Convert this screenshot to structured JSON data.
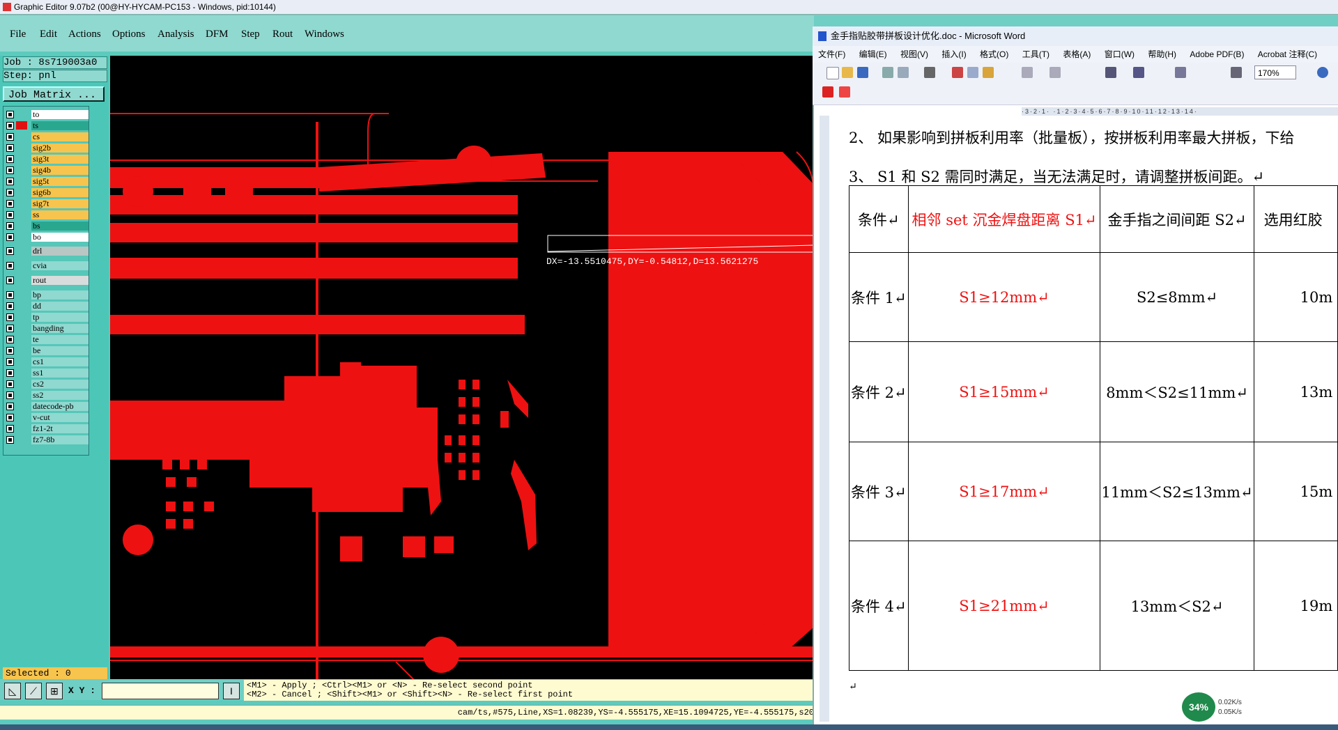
{
  "ge": {
    "title": "Graphic Editor 9.07b2 (00@HY-HYCAM-PC153 - Windows, pid:10144)",
    "menu": [
      "File",
      "Edit",
      "Actions",
      "Options",
      "Analysis",
      "DFM",
      "Step",
      "Rout",
      "Windows"
    ],
    "job": "Job : 8s719003a0",
    "step": "Step: pnl",
    "job_matrix": "Job Matrix ...",
    "layers": [
      {
        "name": "to",
        "color": "#ffffff",
        "swatch": "#000000"
      },
      {
        "name": "ts",
        "color": "#2aa88f",
        "swatch": "#e11111",
        "active": true
      },
      {
        "name": "cs",
        "color": "#f7c44d",
        "swatch": "#000000"
      },
      {
        "name": "sig2b",
        "color": "#f7c44d",
        "swatch": "#000000"
      },
      {
        "name": "sig3t",
        "color": "#f7c44d",
        "swatch": "#000000"
      },
      {
        "name": "sig4b",
        "color": "#f7c44d",
        "swatch": "#000000"
      },
      {
        "name": "sig5t",
        "color": "#f7c44d",
        "swatch": "#000000"
      },
      {
        "name": "sig6b",
        "color": "#f7c44d",
        "swatch": "#000000"
      },
      {
        "name": "sig7t",
        "color": "#f7c44d",
        "swatch": "#000000"
      },
      {
        "name": "ss",
        "color": "#f7c44d",
        "swatch": "#000000"
      },
      {
        "name": "bs",
        "color": "#2aa88f",
        "swatch": "#000000"
      },
      {
        "name": "bo",
        "color": "#ffffff",
        "swatch": "#000000"
      },
      {
        "name": "drl",
        "color": "#b8c6c4",
        "swatch": "#000000",
        "gap": true
      },
      {
        "name": "cvia",
        "color": "#8fd9d0",
        "swatch": "#000000",
        "gap": true
      },
      {
        "name": "rout",
        "color": "#d8dcdc",
        "swatch": "#000000",
        "gap": true
      },
      {
        "name": "bp",
        "color": "#8fd9d0",
        "swatch": "#000000",
        "gap": true
      },
      {
        "name": "dd",
        "color": "#8fd9d0",
        "swatch": "#000000"
      },
      {
        "name": "tp",
        "color": "#8fd9d0",
        "swatch": "#000000"
      },
      {
        "name": "bangding",
        "color": "#8fd9d0",
        "swatch": "#000000"
      },
      {
        "name": "te",
        "color": "#8fd9d0",
        "swatch": "#000000"
      },
      {
        "name": "be",
        "color": "#8fd9d0",
        "swatch": "#000000"
      },
      {
        "name": "cs1",
        "color": "#8fd9d0",
        "swatch": "#000000"
      },
      {
        "name": "ss1",
        "color": "#8fd9d0",
        "swatch": "#000000"
      },
      {
        "name": "cs2",
        "color": "#8fd9d0",
        "swatch": "#000000"
      },
      {
        "name": "ss2",
        "color": "#8fd9d0",
        "swatch": "#000000"
      },
      {
        "name": "datecode-pb",
        "color": "#8fd9d0",
        "swatch": "#000000"
      },
      {
        "name": "v-cut",
        "color": "#8fd9d0",
        "swatch": "#000000"
      },
      {
        "name": "fz1-2t",
        "color": "#8fd9d0",
        "swatch": "#000000"
      },
      {
        "name": "fz7-8b",
        "color": "#8fd9d0",
        "swatch": "#000000"
      }
    ],
    "selected": "Selected : 0",
    "xy_label": "X Y :",
    "hint_line1": "<M1> - Apply  ; <Ctrl><M1> or <N> - Re-select second point",
    "hint_line2": "<M2> - Cancel ; <Shift><M1> or <Shift><N> - Re-select first point",
    "status": "cam/ts,#575,Line,XS=1.08239,YS=-4.555175,XE=15.1094725,YE=-4.555175,s20",
    "measure": "DX=-13.5510475,DY=-0.54812,D=13.5621275",
    "pcb_color": "#ee1111"
  },
  "word": {
    "title": "金手指贴胶带拼板设计优化.doc - Microsoft Word",
    "menu": [
      "文件(F)",
      "编辑(E)",
      "视图(V)",
      "插入(I)",
      "格式(O)",
      "工具(T)",
      "表格(A)",
      "窗口(W)",
      "帮助(H)",
      "Adobe PDF(B)",
      "Acrobat 注释(C)"
    ],
    "zoom": "170%",
    "para2": "2、 如果影响到拼板利用率（批量板），按拼板利用率最大拼板，下给",
    "para3": "3、 S1 和 S2 需同时满足，当无法满足时，请调整拼板间距。↵",
    "headers": [
      "条件↵",
      "相邻 set 沉金焊盘距离 S1↵",
      "金手指之间间距 S2↵",
      "选用红胶"
    ],
    "rows": [
      [
        "条件 1↵",
        "S1≥12mm↵",
        "S2≤8mm↵",
        "10m"
      ],
      [
        "条件 2↵",
        "S1≥15mm↵",
        "8mm＜S2≤11mm↵",
        "13m"
      ],
      [
        "条件 3↵",
        "S1≥17mm↵",
        "11mm＜S2≤13mm↵",
        "15m"
      ],
      [
        "条件 4↵",
        "S1≥21mm↵",
        "13mm＜S2↵",
        "19m"
      ]
    ],
    "after_table": "↵"
  },
  "tray": {
    "percent": "34%",
    "up": "0.02K/s",
    "down": "0.05K/s"
  }
}
